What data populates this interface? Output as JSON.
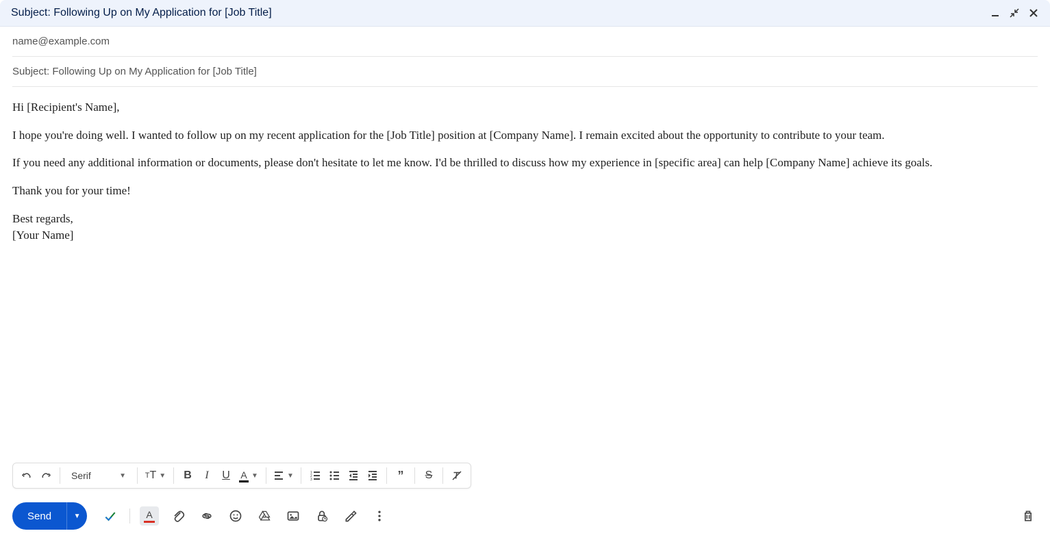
{
  "titlebar": {
    "title": "Subject: Following Up on My Application for [Job Title]"
  },
  "fields": {
    "to": "name@example.com",
    "subject": "Subject: Following Up on My Application for [Job Title]"
  },
  "body": {
    "p1": "Hi [Recipient's Name],",
    "p2": "I hope you're doing well. I wanted to follow up on my recent application for the [Job Title] position at [Company Name]. I remain excited about the opportunity to contribute to your team.",
    "p3": "If you need any additional information or documents, please don't hesitate to let me know. I'd be thrilled to discuss how my experience in [specific area] can help [Company Name] achieve its goals.",
    "p4": "Thank you for your time!",
    "p5": "Best regards,",
    "p6": "[Your Name]"
  },
  "format_toolbar": {
    "font": "Serif"
  },
  "bottom": {
    "send": "Send"
  }
}
